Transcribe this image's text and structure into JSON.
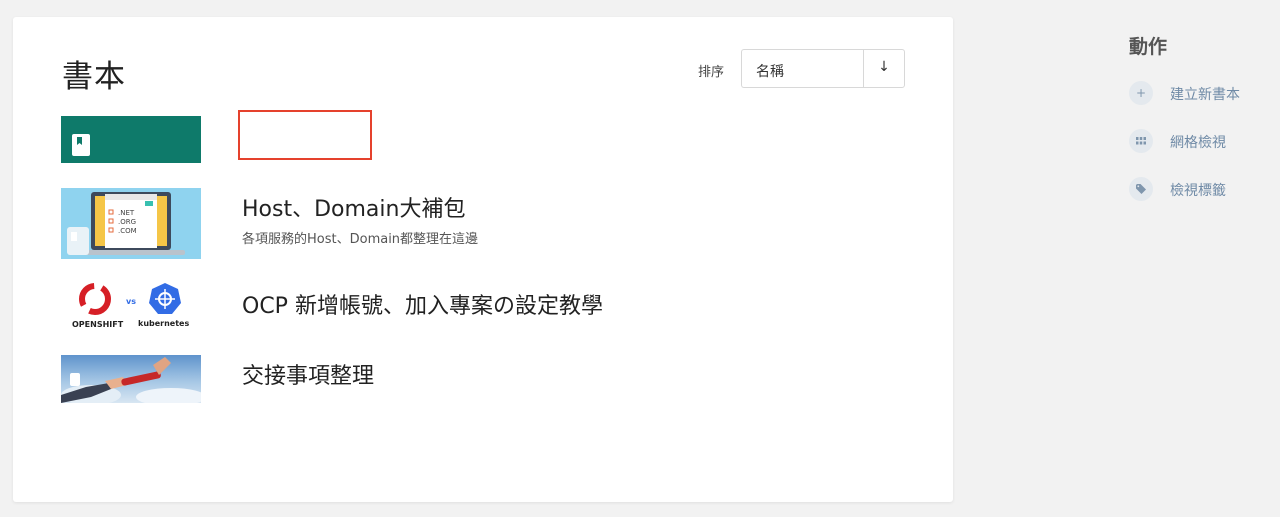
{
  "page": {
    "title": "書本"
  },
  "sort": {
    "label": "排序",
    "value": "名稱",
    "direction_symbol": "↓"
  },
  "books": [
    {
      "title": "",
      "description": "",
      "thumb_color": "#0e7a6a"
    },
    {
      "title": "Host、Domain大補包",
      "description": "各項服務的Host、Domain都整理在這邊",
      "thumb_texts": [
        ".NET",
        ".ORG",
        ".COM"
      ]
    },
    {
      "title": "OCP 新增帳號、加入專案の設定教學",
      "description": "",
      "thumb_texts": [
        "OPENSHIFT",
        "vs",
        "kubernetes"
      ]
    },
    {
      "title": "交接事項整理",
      "description": ""
    }
  ],
  "actions": {
    "title": "動作",
    "items": [
      {
        "label": "建立新書本",
        "icon": "plus-icon"
      },
      {
        "label": "網格檢視",
        "icon": "grid-icon"
      },
      {
        "label": "檢視標籤",
        "icon": "tag-icon"
      }
    ]
  },
  "colors": {
    "accent": "#0e7a6a",
    "link": "#6f8aa6",
    "highlight_border": "#e5412d"
  }
}
